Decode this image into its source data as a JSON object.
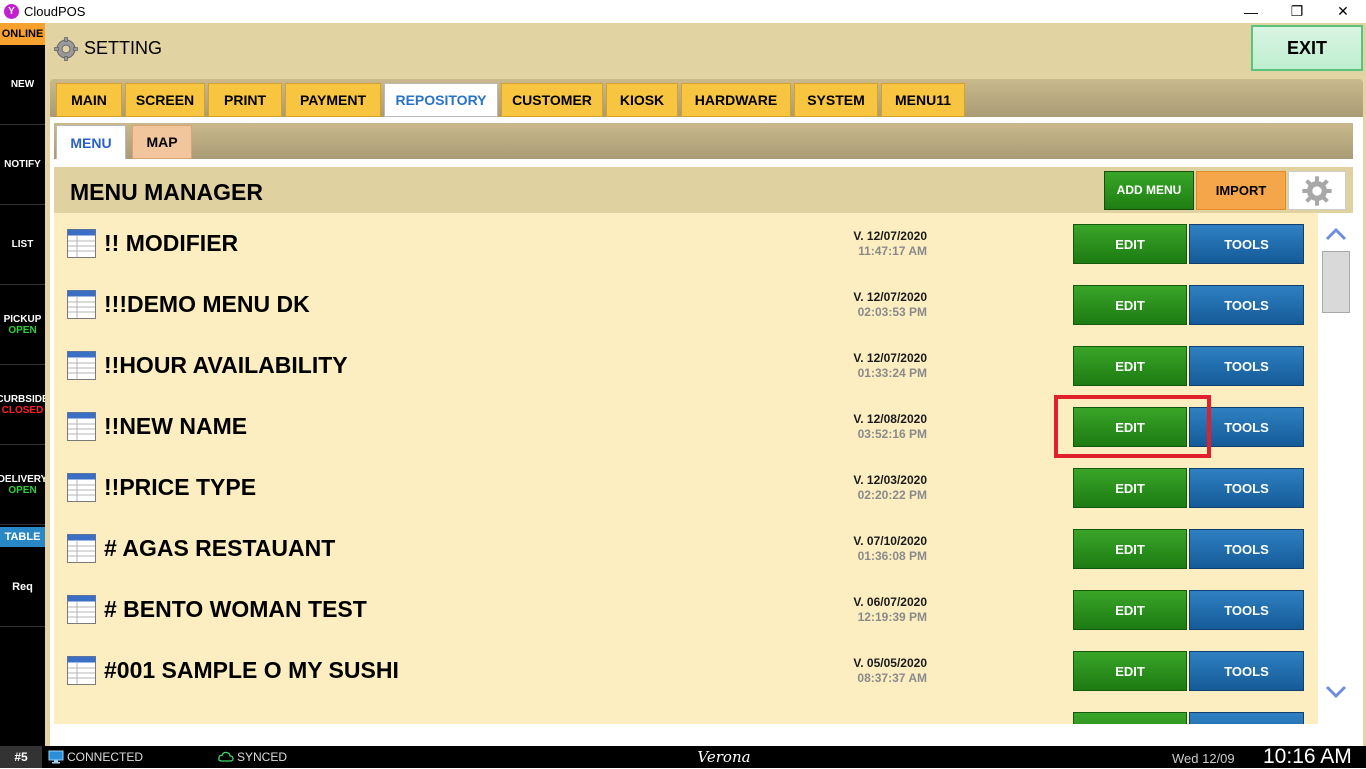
{
  "window": {
    "title": "CloudPOS",
    "logo_letter": "Y",
    "minimize": "—",
    "maximize": "❐",
    "close": "✕"
  },
  "sidebar": {
    "status": "ONLINE",
    "items": [
      {
        "label": "NEW"
      },
      {
        "label": "NOTIFY"
      },
      {
        "label": "LIST"
      },
      {
        "label": "PICKUP",
        "sub": "OPEN"
      },
      {
        "label": "CURBSIDE",
        "sub": "CLOSED"
      },
      {
        "label": "DELIVERY",
        "sub": "OPEN"
      }
    ],
    "table": "TABLE",
    "req": "Req"
  },
  "header": {
    "title": "SETTING",
    "exit": "EXIT"
  },
  "tabs": [
    "MAIN",
    "SCREEN",
    "PRINT",
    "PAYMENT",
    "REPOSITORY",
    "CUSTOMER",
    "KIOSK",
    "HARDWARE",
    "SYSTEM",
    "MENU11"
  ],
  "active_tab": "REPOSITORY",
  "subtabs": [
    "MENU",
    "MAP"
  ],
  "manager": {
    "title": "MENU MANAGER",
    "add_menu": "ADD MENU",
    "import": "IMPORT"
  },
  "buttons": {
    "edit": "EDIT",
    "tools": "TOOLS"
  },
  "menus": [
    {
      "name": "!! MODIFIER",
      "version": "V. 12/07/2020",
      "time": "11:47:17 AM"
    },
    {
      "name": "!!!DEMO MENU DK",
      "version": "V. 12/07/2020",
      "time": "02:03:53 PM"
    },
    {
      "name": "!!HOUR AVAILABILITY",
      "version": "V. 12/07/2020",
      "time": "01:33:24 PM"
    },
    {
      "name": "!!NEW NAME",
      "version": "V. 12/08/2020",
      "time": "03:52:16 PM"
    },
    {
      "name": "!!PRICE TYPE",
      "version": "V. 12/03/2020",
      "time": "02:20:22 PM"
    },
    {
      "name": "# AGAS RESTAUANT",
      "version": "V. 07/10/2020",
      "time": "01:36:08 PM"
    },
    {
      "name": "# BENTO WOMAN TEST",
      "version": "V. 06/07/2020",
      "time": "12:19:39 PM"
    },
    {
      "name": "#001 SAMPLE O MY SUSHI",
      "version": "V. 05/05/2020",
      "time": "08:37:37 AM"
    }
  ],
  "status_bar": {
    "station": "#5",
    "connection": "CONNECTED",
    "sync": "SYNCED",
    "store": "Verona",
    "date": "Wed 12/09",
    "time": "10:16 AM"
  },
  "colors": {
    "edit": "#1f7e13",
    "tools": "#155b98",
    "highlight": "#e0202a"
  }
}
